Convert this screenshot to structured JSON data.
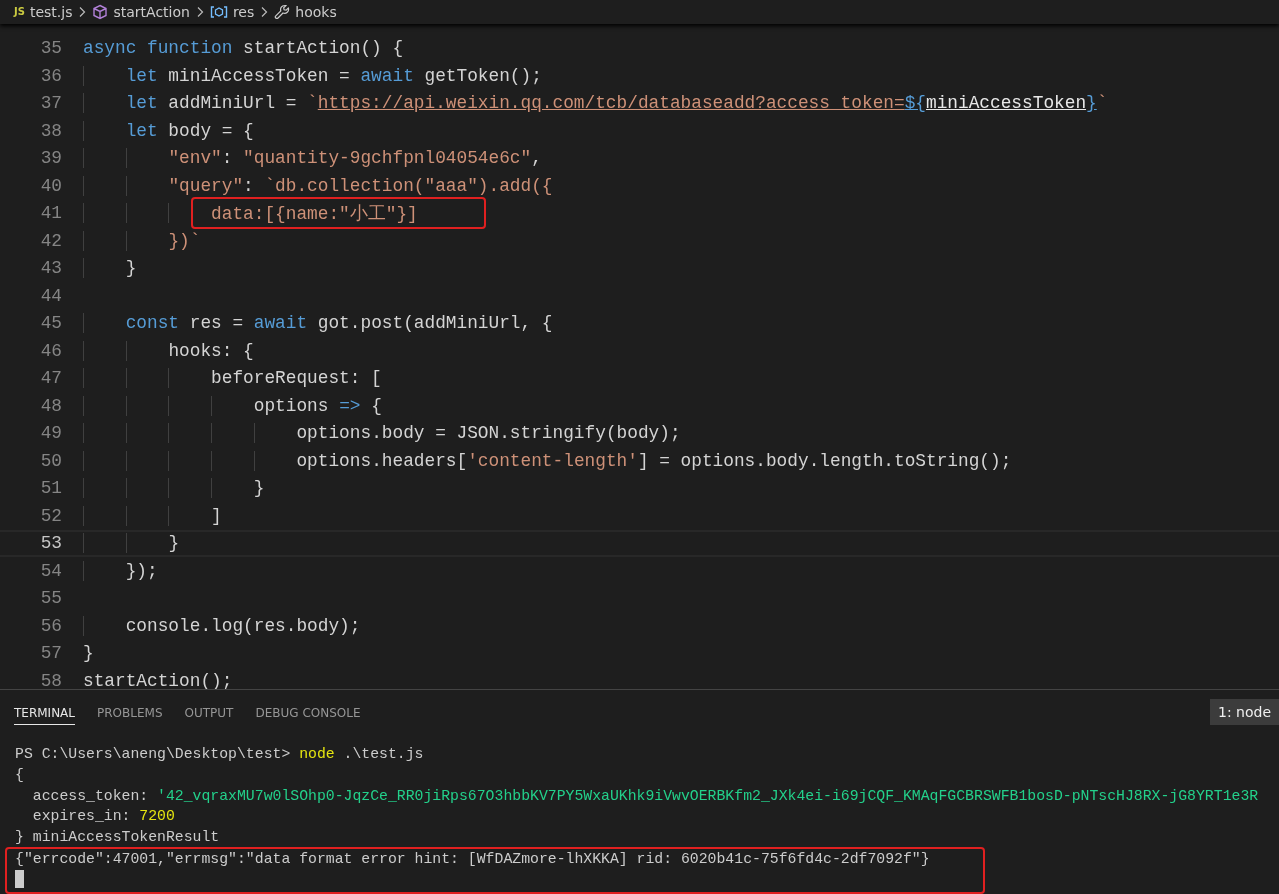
{
  "breadcrumb": [
    {
      "kind": "file",
      "badge": "JS",
      "label": "test.js"
    },
    {
      "kind": "function",
      "label": "startAction"
    },
    {
      "kind": "variable",
      "label": "res"
    },
    {
      "kind": "property",
      "label": "hooks"
    }
  ],
  "editor": {
    "lines": [
      {
        "number": "35",
        "current": false,
        "highlighted": false,
        "tokens": [
          {
            "kind": "kw",
            "text": "async"
          },
          {
            "kind": "kw",
            "text": " function"
          },
          {
            "kind": "text",
            "text": " startAction() {"
          }
        ]
      },
      {
        "number": "36",
        "current": false,
        "highlighted": false,
        "tokens": [
          {
            "kind": "kw",
            "text": "    let"
          },
          {
            "kind": "text",
            "text": " miniAccessToken = "
          },
          {
            "kind": "kw",
            "text": "await"
          },
          {
            "kind": "text",
            "text": " getToken();"
          }
        ]
      },
      {
        "number": "37",
        "current": false,
        "highlighted": false,
        "tokens": [
          {
            "kind": "kw",
            "text": "    let"
          },
          {
            "kind": "text",
            "text": " addMiniUrl = "
          },
          {
            "kind": "str",
            "text": "`"
          },
          {
            "kind": "link",
            "text": "https://api.weixin.qq.com/tcb/databaseadd?access_token="
          },
          {
            "kind": "interp",
            "text": "${"
          },
          {
            "kind": "uvar",
            "text": "miniAccessToken"
          },
          {
            "kind": "interp",
            "text": "}"
          },
          {
            "kind": "str",
            "text": "`"
          }
        ]
      },
      {
        "number": "38",
        "current": false,
        "highlighted": false,
        "tokens": [
          {
            "kind": "kw",
            "text": "    let"
          },
          {
            "kind": "text",
            "text": " body = {"
          }
        ]
      },
      {
        "number": "39",
        "current": false,
        "highlighted": false,
        "tokens": [
          {
            "kind": "str",
            "text": "        \"env\""
          },
          {
            "kind": "text",
            "text": ": "
          },
          {
            "kind": "str",
            "text": "\"quantity-9gchfpnl04054e6c\""
          },
          {
            "kind": "text",
            "text": ","
          }
        ]
      },
      {
        "number": "40",
        "current": false,
        "highlighted": false,
        "tokens": [
          {
            "kind": "str",
            "text": "        \"query\""
          },
          {
            "kind": "text",
            "text": ": "
          },
          {
            "kind": "str",
            "text": "`db.collection(\"aaa\").add({"
          }
        ]
      },
      {
        "number": "41",
        "current": false,
        "highlighted": true,
        "tokens": [
          {
            "kind": "str",
            "text": "            data:[{name:\"小工\"}]"
          }
        ]
      },
      {
        "number": "42",
        "current": false,
        "highlighted": false,
        "tokens": [
          {
            "kind": "str",
            "text": "        })`"
          }
        ]
      },
      {
        "number": "43",
        "current": false,
        "highlighted": false,
        "tokens": [
          {
            "kind": "text",
            "text": "    }"
          }
        ]
      },
      {
        "number": "44",
        "current": false,
        "highlighted": false
      },
      {
        "number": "45",
        "current": false,
        "highlighted": false,
        "tokens": [
          {
            "kind": "kw",
            "text": "    const"
          },
          {
            "kind": "text",
            "text": " res = "
          },
          {
            "kind": "kw",
            "text": "await"
          },
          {
            "kind": "text",
            "text": " got.post(addMiniUrl, {"
          }
        ]
      },
      {
        "number": "46",
        "current": false,
        "highlighted": false,
        "tokens": [
          {
            "kind": "text",
            "text": "        hooks: {"
          }
        ]
      },
      {
        "number": "47",
        "current": false,
        "highlighted": false,
        "tokens": [
          {
            "kind": "text",
            "text": "            beforeRequest: ["
          }
        ]
      },
      {
        "number": "48",
        "current": false,
        "highlighted": false,
        "tokens": [
          {
            "kind": "text",
            "text": "                options "
          },
          {
            "kind": "kw",
            "text": "=>"
          },
          {
            "kind": "text",
            "text": " {"
          }
        ]
      },
      {
        "number": "49",
        "current": false,
        "highlighted": false,
        "tokens": [
          {
            "kind": "text",
            "text": "                    options.body = JSON.stringify(body);"
          }
        ]
      },
      {
        "number": "50",
        "current": false,
        "highlighted": false,
        "tokens": [
          {
            "kind": "text",
            "text": "                    options.headers["
          },
          {
            "kind": "str",
            "text": "'content-length'"
          },
          {
            "kind": "text",
            "text": "] = options.body.length.toString();"
          }
        ]
      },
      {
        "number": "51",
        "current": false,
        "highlighted": false,
        "tokens": [
          {
            "kind": "text",
            "text": "                }"
          }
        ]
      },
      {
        "number": "52",
        "current": false,
        "highlighted": false,
        "tokens": [
          {
            "kind": "text",
            "text": "            ]"
          }
        ]
      },
      {
        "number": "53",
        "current": true,
        "highlighted": false,
        "tokens": [
          {
            "kind": "text",
            "text": "        }"
          }
        ]
      },
      {
        "number": "54",
        "current": false,
        "highlighted": false,
        "tokens": [
          {
            "kind": "text",
            "text": "    });"
          }
        ]
      },
      {
        "number": "55",
        "current": false,
        "highlighted": false
      },
      {
        "number": "56",
        "current": false,
        "highlighted": false,
        "tokens": [
          {
            "kind": "text",
            "text": "    console.log(res.body);"
          }
        ]
      },
      {
        "number": "57",
        "current": false,
        "highlighted": false,
        "tokens": [
          {
            "kind": "text",
            "text": "}"
          }
        ]
      },
      {
        "number": "58",
        "current": false,
        "highlighted": false,
        "tokens": [
          {
            "kind": "text",
            "text": "startAction();"
          }
        ]
      }
    ]
  },
  "panel": {
    "tabs": [
      {
        "label": "TERMINAL",
        "selected": true
      },
      {
        "label": "PROBLEMS",
        "selected": false
      },
      {
        "label": "OUTPUT",
        "selected": false
      },
      {
        "label": "DEBUG CONSOLE",
        "selected": false
      }
    ],
    "terminal_selector": "1: node",
    "terminal": {
      "lines": [
        {
          "highlighted": false,
          "cursor": false,
          "tokens": [
            {
              "kind": "text",
              "text": "PS C:\\Users\\aneng\\Desktop\\test> "
            },
            {
              "kind": "cmd",
              "text": "node"
            },
            {
              "kind": "text",
              "text": " .\\test.js"
            }
          ]
        },
        {
          "highlighted": false,
          "cursor": false,
          "tokens": [
            {
              "kind": "text",
              "text": "{"
            }
          ]
        },
        {
          "highlighted": false,
          "cursor": false,
          "tokens": [
            {
              "kind": "text",
              "text": "  access_token: "
            },
            {
              "kind": "str",
              "text": "'42_vqraxMU7w0lSOhp0-JqzCe_RR0jiRps67O3hbbKV7PY5WxaUKhk9iVwvOERBKfm2_JXk4ei-i69jCQF_KMAqFGCBRSWFB1bosD-pNTscHJ8RX-jG8YRT1e3R"
            }
          ]
        },
        {
          "highlighted": false,
          "cursor": false,
          "tokens": [
            {
              "kind": "text",
              "text": "  expires_in: "
            },
            {
              "kind": "num",
              "text": "7200"
            }
          ]
        },
        {
          "highlighted": false,
          "cursor": false,
          "tokens": [
            {
              "kind": "text",
              "text": "} miniAccessTokenResult"
            }
          ]
        },
        {
          "highlighted": true,
          "cursor": true,
          "tokens": [
            {
              "kind": "text",
              "text": "{\"errcode\":47001,\"errmsg\":\"data format error hint: [WfDAZmore-lhXKKA] rid: 6020b41c-75f6fd4c-2df7092f\"}"
            }
          ]
        }
      ]
    }
  }
}
